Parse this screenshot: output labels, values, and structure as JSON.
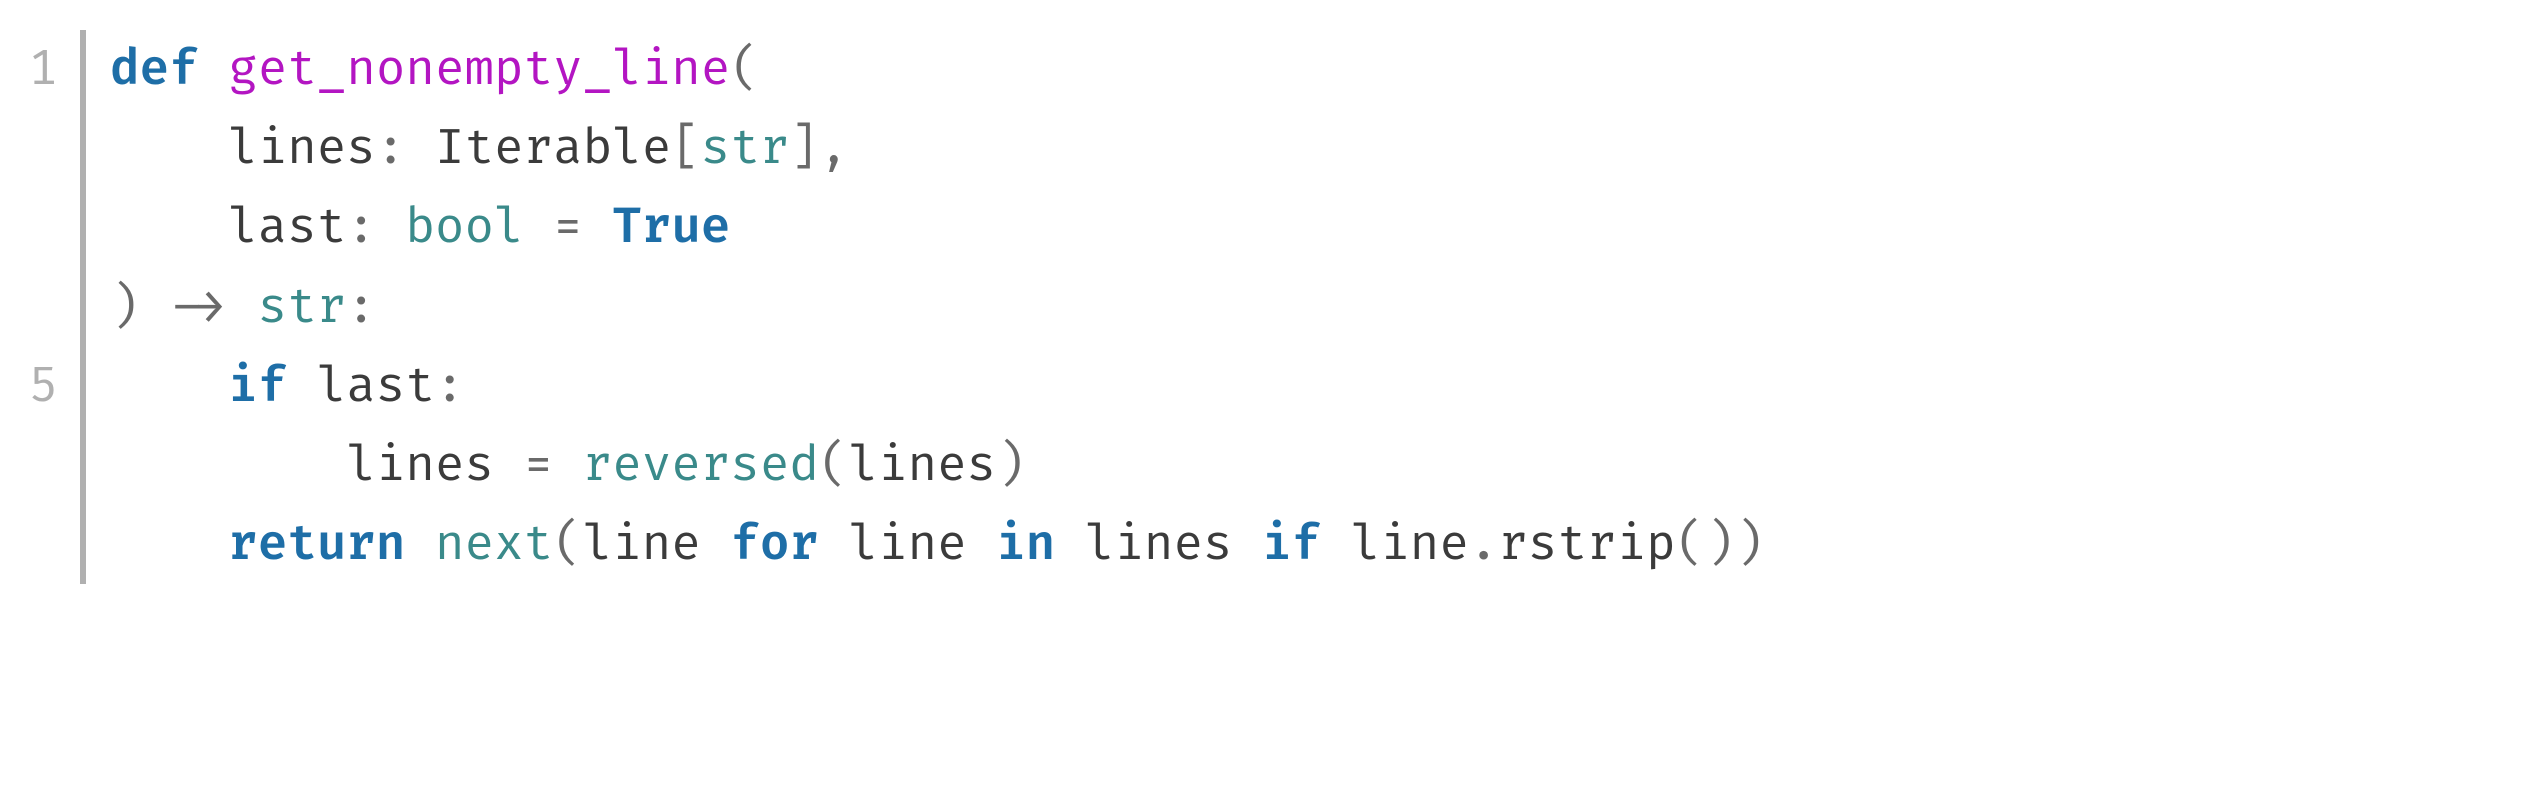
{
  "chart_data": {
    "type": "table",
    "title": "Python code listing: get_nonempty_line",
    "language": "python",
    "line_number_start": 1,
    "shown_line_numbers": [
      1,
      5
    ],
    "lines": [
      {
        "n": 1,
        "tokens": [
          {
            "t": "def",
            "c": "kw"
          },
          {
            "t": " ",
            "c": "sp"
          },
          {
            "t": "get_nonempty_line",
            "c": "fn"
          },
          {
            "t": "(",
            "c": "pun"
          }
        ]
      },
      {
        "n": 2,
        "tokens": [
          {
            "t": "    ",
            "c": "sp"
          },
          {
            "t": "lines",
            "c": "nm"
          },
          {
            "t": ": ",
            "c": "pun"
          },
          {
            "t": "Iterable",
            "c": "nm"
          },
          {
            "t": "[",
            "c": "pun"
          },
          {
            "t": "str",
            "c": "ty"
          },
          {
            "t": "]",
            "c": "pun"
          },
          {
            "t": ",",
            "c": "pun"
          }
        ]
      },
      {
        "n": 3,
        "tokens": [
          {
            "t": "    ",
            "c": "sp"
          },
          {
            "t": "last",
            "c": "nm"
          },
          {
            "t": ": ",
            "c": "pun"
          },
          {
            "t": "bool",
            "c": "ty"
          },
          {
            "t": " ",
            "c": "sp"
          },
          {
            "t": "=",
            "c": "op"
          },
          {
            "t": " ",
            "c": "sp"
          },
          {
            "t": "True",
            "c": "const"
          }
        ]
      },
      {
        "n": 4,
        "tokens": [
          {
            "t": ")",
            "c": "pun"
          },
          {
            "t": " ",
            "c": "sp"
          },
          {
            "t": "->",
            "c": "op"
          },
          {
            "t": " ",
            "c": "sp"
          },
          {
            "t": "str",
            "c": "ty"
          },
          {
            "t": ":",
            "c": "pun"
          }
        ]
      },
      {
        "n": 5,
        "tokens": [
          {
            "t": "    ",
            "c": "sp"
          },
          {
            "t": "if",
            "c": "kw"
          },
          {
            "t": " ",
            "c": "sp"
          },
          {
            "t": "last",
            "c": "nm"
          },
          {
            "t": ":",
            "c": "pun"
          }
        ]
      },
      {
        "n": 6,
        "tokens": [
          {
            "t": "        ",
            "c": "sp"
          },
          {
            "t": "lines",
            "c": "nm"
          },
          {
            "t": " ",
            "c": "sp"
          },
          {
            "t": "=",
            "c": "op"
          },
          {
            "t": " ",
            "c": "sp"
          },
          {
            "t": "reversed",
            "c": "ty"
          },
          {
            "t": "(",
            "c": "pun"
          },
          {
            "t": "lines",
            "c": "nm"
          },
          {
            "t": ")",
            "c": "pun"
          }
        ]
      },
      {
        "n": 7,
        "tokens": [
          {
            "t": "    ",
            "c": "sp"
          },
          {
            "t": "return",
            "c": "kw"
          },
          {
            "t": " ",
            "c": "sp"
          },
          {
            "t": "next",
            "c": "ty"
          },
          {
            "t": "(",
            "c": "pun"
          },
          {
            "t": "line",
            "c": "nm"
          },
          {
            "t": " ",
            "c": "sp"
          },
          {
            "t": "for",
            "c": "kw"
          },
          {
            "t": " ",
            "c": "sp"
          },
          {
            "t": "line",
            "c": "nm"
          },
          {
            "t": " ",
            "c": "sp"
          },
          {
            "t": "in",
            "c": "kw"
          },
          {
            "t": " ",
            "c": "sp"
          },
          {
            "t": "lines",
            "c": "nm"
          },
          {
            "t": " ",
            "c": "sp"
          },
          {
            "t": "if",
            "c": "kw"
          },
          {
            "t": " ",
            "c": "sp"
          },
          {
            "t": "line",
            "c": "nm"
          },
          {
            "t": ".",
            "c": "pun"
          },
          {
            "t": "rstrip",
            "c": "nm"
          },
          {
            "t": "())",
            "c": "pun"
          }
        ]
      }
    ]
  },
  "gutter": {
    "n1": "1",
    "n5": "5"
  }
}
